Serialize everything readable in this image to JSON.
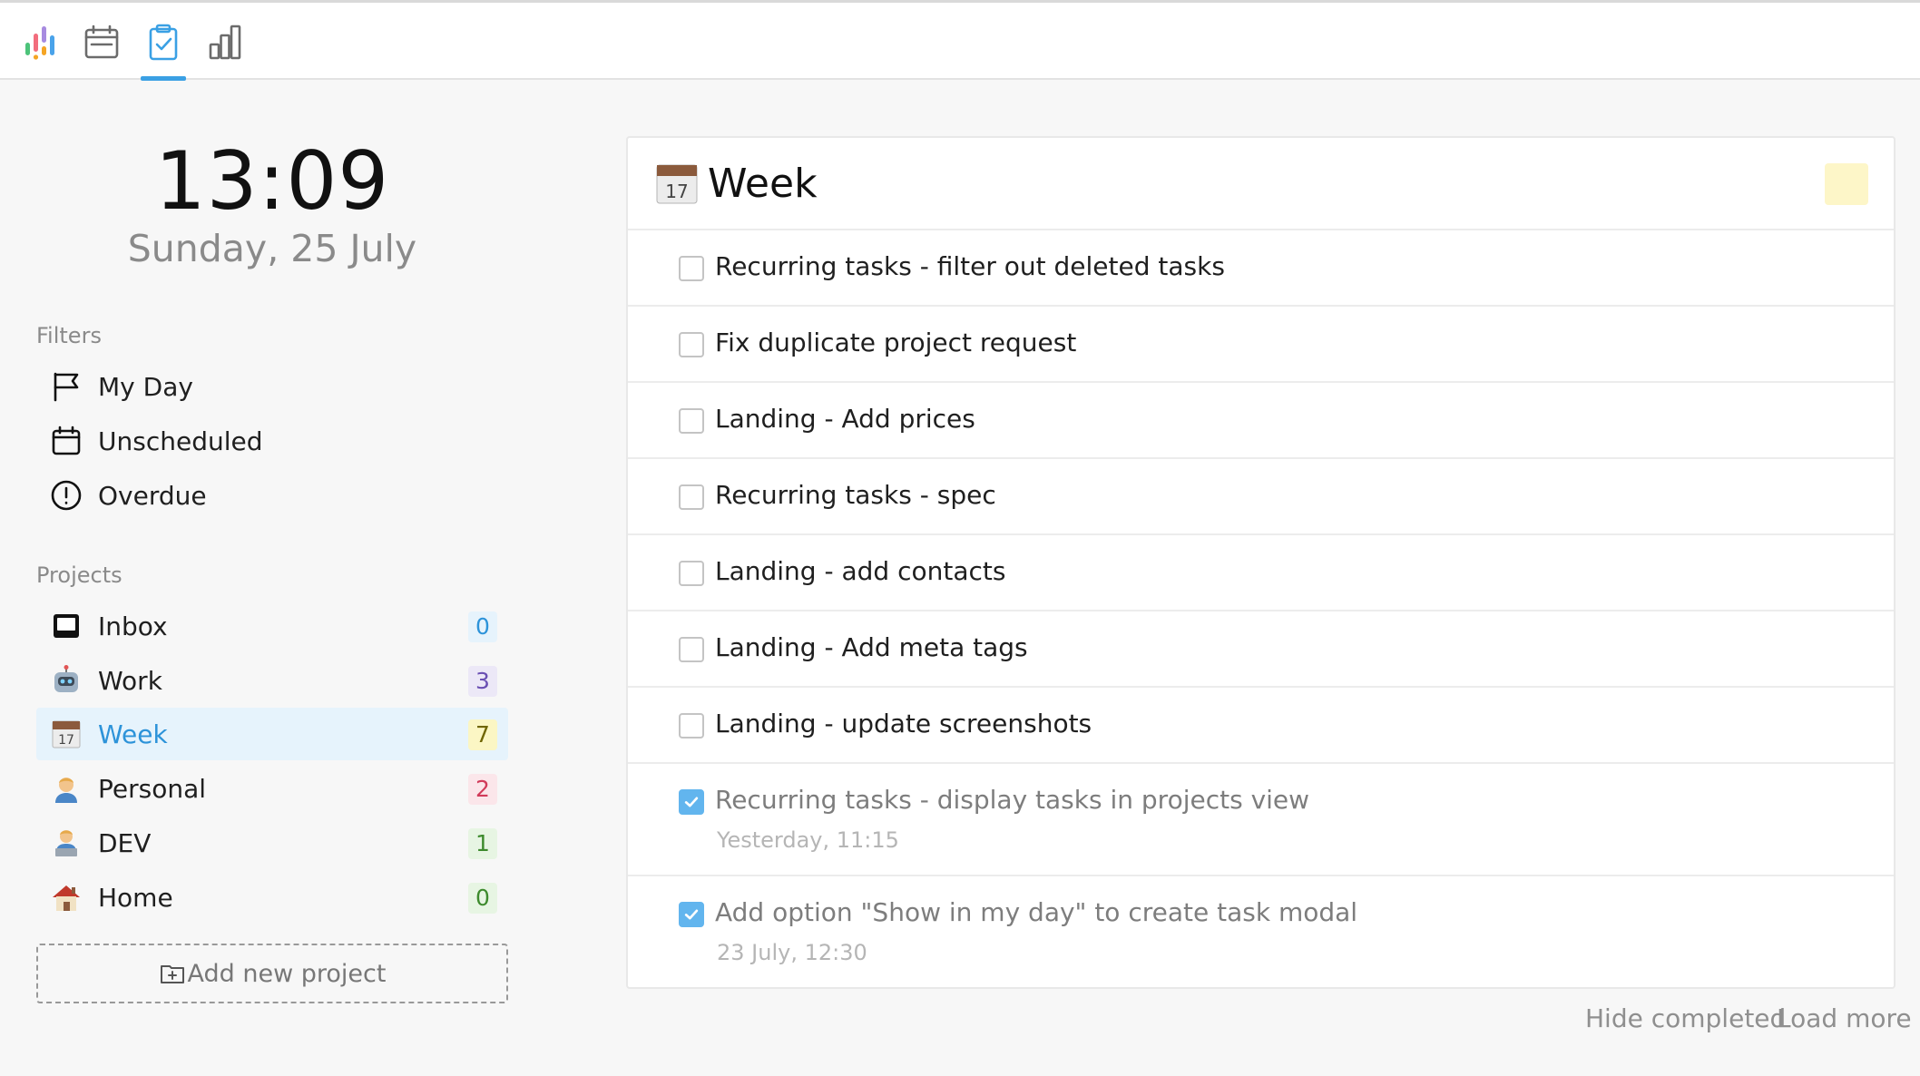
{
  "toolbar": {
    "icons": [
      "app-logo-icon",
      "calendar-icon",
      "tasks-clipboard-icon",
      "stats-bar-chart-icon"
    ],
    "active": "tasks-clipboard-icon",
    "accent": "#3aa0e4"
  },
  "sidebar": {
    "time": "13:09",
    "date": "Sunday, 25 July",
    "filters_title": "Filters",
    "filters": [
      {
        "label": "My Day",
        "icon": "flag-icon"
      },
      {
        "label": "Unscheduled",
        "icon": "calendar-icon"
      },
      {
        "label": "Overdue",
        "icon": "alert-circle-icon"
      }
    ],
    "projects_title": "Projects",
    "projects": [
      {
        "label": "Inbox",
        "icon": "inbox-icon",
        "count": "0",
        "badge_bg": "#e6f3fc",
        "badge_fg": "#2d93d9"
      },
      {
        "label": "Work",
        "icon": "robot-emoji-icon",
        "count": "3",
        "badge_bg": "#ece8f7",
        "badge_fg": "#6a4fb3"
      },
      {
        "label": "Week",
        "icon": "calendar-emoji-icon",
        "count": "7",
        "badge_bg": "#fbf6c4",
        "badge_fg": "#6f6500",
        "active": true
      },
      {
        "label": "Personal",
        "icon": "person-emoji-icon",
        "count": "2",
        "badge_bg": "#fbe6ea",
        "badge_fg": "#d13b5a"
      },
      {
        "label": "DEV",
        "icon": "technologist-emoji-icon",
        "count": "1",
        "badge_bg": "#e7f5e3",
        "badge_fg": "#3d8a2d"
      },
      {
        "label": "Home",
        "icon": "house-emoji-icon",
        "count": "0",
        "badge_bg": "#e7f5e3",
        "badge_fg": "#3d8a2d"
      }
    ],
    "add_project_label": "Add new project"
  },
  "main": {
    "title": "Week",
    "title_icon": "calendar-emoji-icon",
    "swatch_color": "#fdf6c8",
    "tasks": [
      {
        "title": "Recurring tasks - filter out deleted tasks",
        "done": false
      },
      {
        "title": "Fix duplicate project request",
        "done": false
      },
      {
        "title": "Landing - Add prices",
        "done": false
      },
      {
        "title": "Recurring tasks - spec",
        "done": false
      },
      {
        "title": "Landing - add contacts",
        "done": false
      },
      {
        "title": "Landing - Add meta tags",
        "done": false
      },
      {
        "title": "Landing - update screenshots",
        "done": false
      },
      {
        "title": "Recurring tasks - display tasks in projects view",
        "done": true,
        "completed_at": "Yesterday, 11:15"
      },
      {
        "title": "Add option \"Show in my day\" to create task modal",
        "done": true,
        "completed_at": "23 July, 12:30"
      }
    ],
    "hide_completed_label": "Hide completed",
    "load_more_label": "Load more"
  }
}
